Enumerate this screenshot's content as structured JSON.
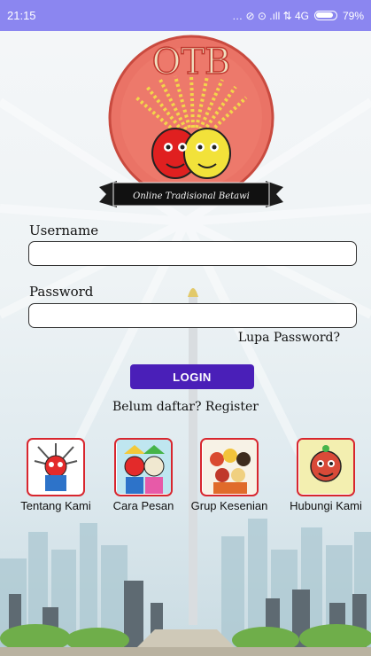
{
  "status": {
    "time": "21:15",
    "indicators": "… ⊘ ⊙ .ıll ⇅ 4G",
    "battery": "79%"
  },
  "logo": {
    "title": "OTB",
    "ribbon": "Online Tradisional Betawi"
  },
  "form": {
    "username_label": "Username",
    "username_value": "",
    "password_label": "Password",
    "password_value": "",
    "forgot": "Lupa Password?",
    "login_button": "LOGIN",
    "register_text": "Belum daftar? Register"
  },
  "menu": [
    {
      "label": "Tentang Kami",
      "icon": "ondel-ondel-icon"
    },
    {
      "label": "Cara Pesan",
      "icon": "ondel-couple-icon"
    },
    {
      "label": "Grup Kesenian",
      "icon": "performers-icon"
    },
    {
      "label": "Hubungi Kami",
      "icon": "mascot-icon"
    }
  ],
  "colors": {
    "status_bar": "#8b86f0",
    "login_button": "#4a1fb8",
    "menu_border": "#d8262e"
  }
}
